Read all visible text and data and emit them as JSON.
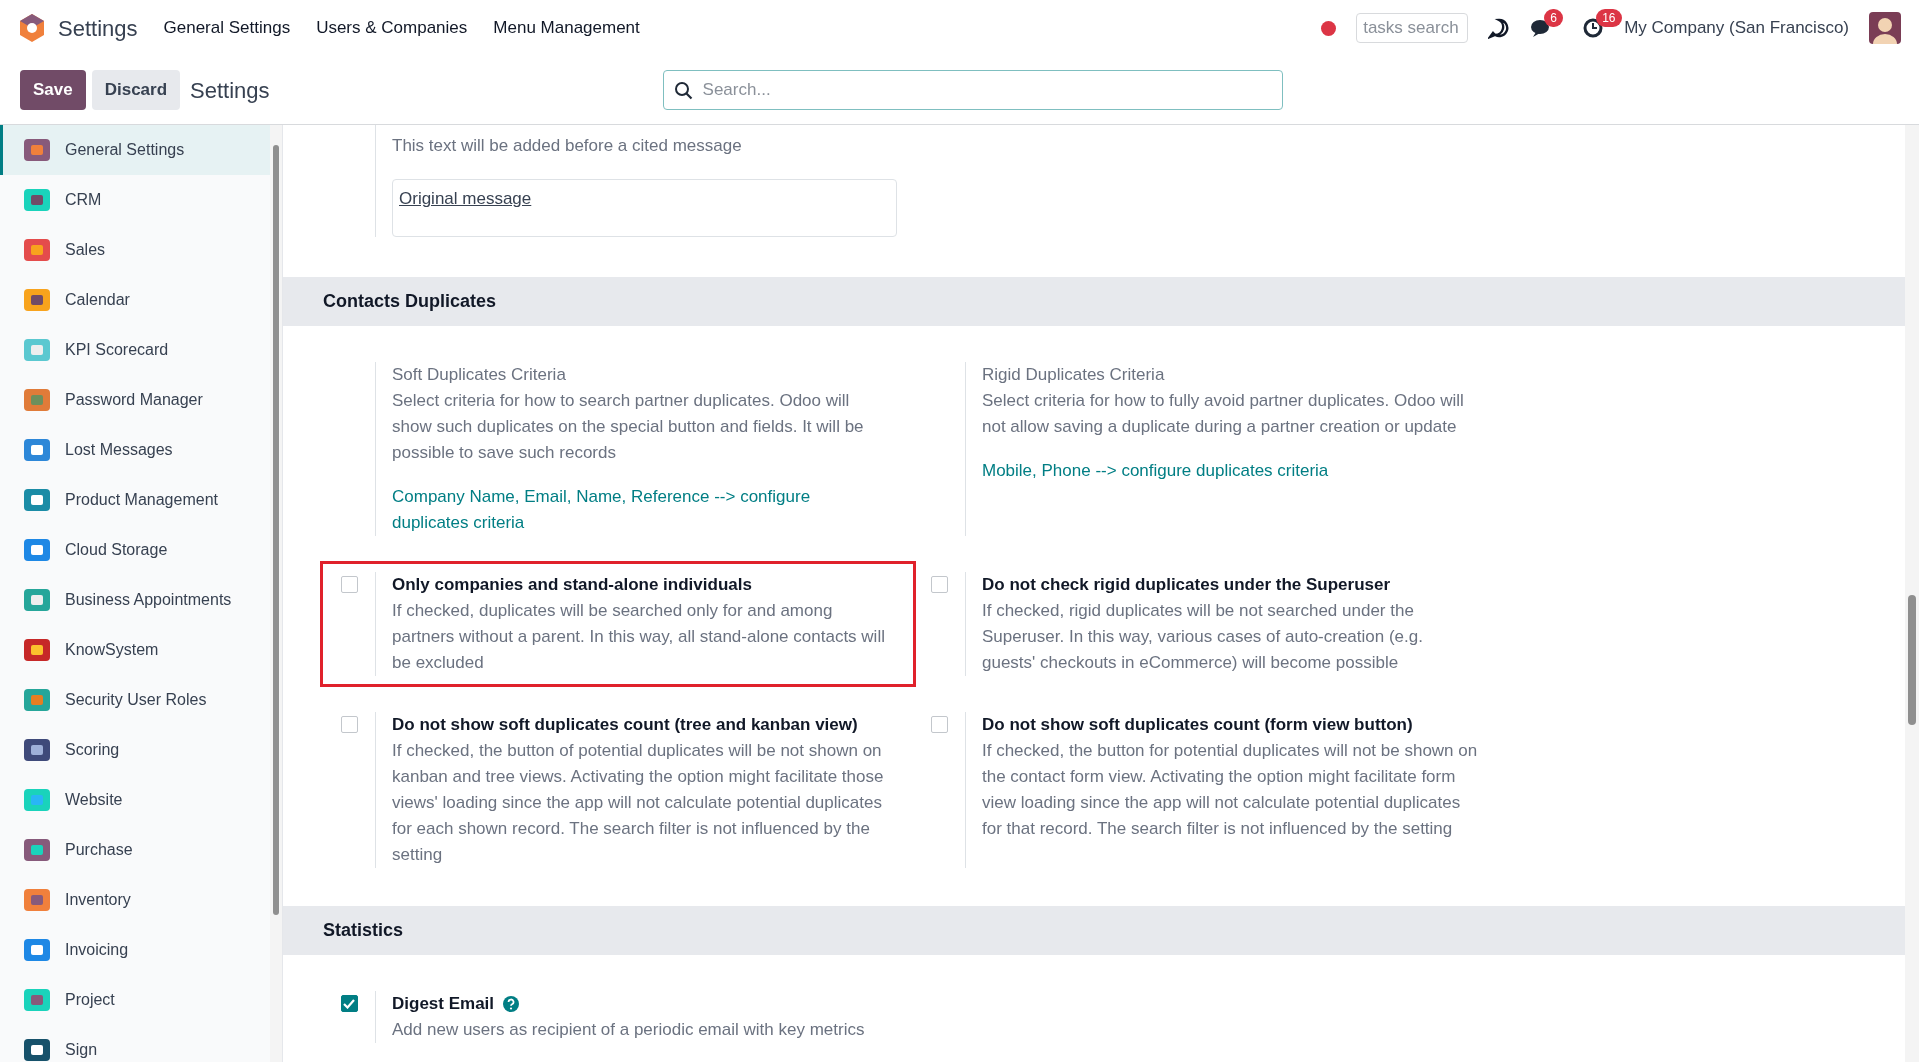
{
  "topbar": {
    "app": "Settings",
    "menu": [
      "General Settings",
      "Users & Companies",
      "Menu Management"
    ],
    "recording": true,
    "tasks_search": {
      "placeholder": "tasks search"
    },
    "messages_badge": "6",
    "activities_badge": "16",
    "company": "My Company (San Francisco)"
  },
  "controlbar": {
    "buttons": [
      {
        "label": "Save",
        "kind": "primary"
      },
      {
        "label": "Discard",
        "kind": "secondary"
      }
    ],
    "title": "Settings",
    "search": {
      "placeholder": "Search..."
    }
  },
  "sidebar": {
    "items": [
      {
        "label": "General Settings",
        "selected": true
      },
      {
        "label": "CRM",
        "selected": false
      },
      {
        "label": "Sales",
        "selected": false
      },
      {
        "label": "Calendar",
        "selected": false
      },
      {
        "label": "KPI Scorecard",
        "selected": false
      },
      {
        "label": "Password Manager",
        "selected": false
      },
      {
        "label": "Lost Messages",
        "selected": false
      },
      {
        "label": "Product Management",
        "selected": false
      },
      {
        "label": "Cloud Storage",
        "selected": false
      },
      {
        "label": "Business Appointments",
        "selected": false
      },
      {
        "label": "KnowSystem",
        "selected": false
      },
      {
        "label": "Security User Roles",
        "selected": false
      },
      {
        "label": "Scoring",
        "selected": false
      },
      {
        "label": "Website",
        "selected": false
      },
      {
        "label": "Purchase",
        "selected": false
      },
      {
        "label": "Inventory",
        "selected": false
      },
      {
        "label": "Invoicing",
        "selected": false
      },
      {
        "label": "Project",
        "selected": false
      },
      {
        "label": "Sign",
        "selected": false
      }
    ]
  },
  "cited_message": {
    "description": "This text will be added before a cited message",
    "value": "Original message"
  },
  "sections": [
    {
      "title": "Contacts Duplicates",
      "settings": [
        {
          "kind": "info",
          "label": "Soft Duplicates Criteria",
          "description": "Select criteria for how to search partner duplicates. Odoo will show such duplicates on the special button and fields. It will be possible to save such records",
          "link": "Company Name, Email, Name, Reference --> configure duplicates criteria"
        },
        {
          "kind": "info",
          "label": "Rigid Duplicates Criteria",
          "description": "Select criteria for how to fully avoid partner duplicates. Odoo will not allow saving a duplicate during a partner creation or update",
          "link": "Mobile, Phone --> configure duplicates criteria"
        },
        {
          "kind": "checkbox",
          "label": "Only companies and stand-alone individuals",
          "checked": false,
          "highlighted": true,
          "description": "If checked, duplicates will be searched only for and among partners without a parent. In this way, all stand-alone contacts will be excluded"
        },
        {
          "kind": "checkbox",
          "label": "Do not check rigid duplicates under the Superuser",
          "checked": false,
          "description": "If checked, rigid duplicates will be not searched under the Superuser. In this way, various cases of auto-creation (e.g. guests' checkouts in eCommerce) will become possible"
        },
        {
          "kind": "checkbox",
          "label": "Do not show soft duplicates count (tree and kanban view)",
          "checked": false,
          "description": "If checked, the button of potential duplicates will be not shown on kanban and tree views. Activating the option might facilitate those views' loading since the app will not calculate potential duplicates for each shown record. The search filter is not influenced by the setting"
        },
        {
          "kind": "checkbox",
          "label": "Do not show soft duplicates count (form view button)",
          "checked": false,
          "description": "If checked, the button for potential duplicates will not be shown on the contact form view. Activating the option might facilitate form view loading since the app will not calculate potential duplicates for that record. The search filter is not influenced by the setting"
        }
      ]
    },
    {
      "title": "Statistics",
      "settings": [
        {
          "kind": "checkbox",
          "label": "Digest Email",
          "checked": true,
          "help": true,
          "description": "Add new users as recipient of a periodic email with key metrics"
        }
      ]
    }
  ]
}
